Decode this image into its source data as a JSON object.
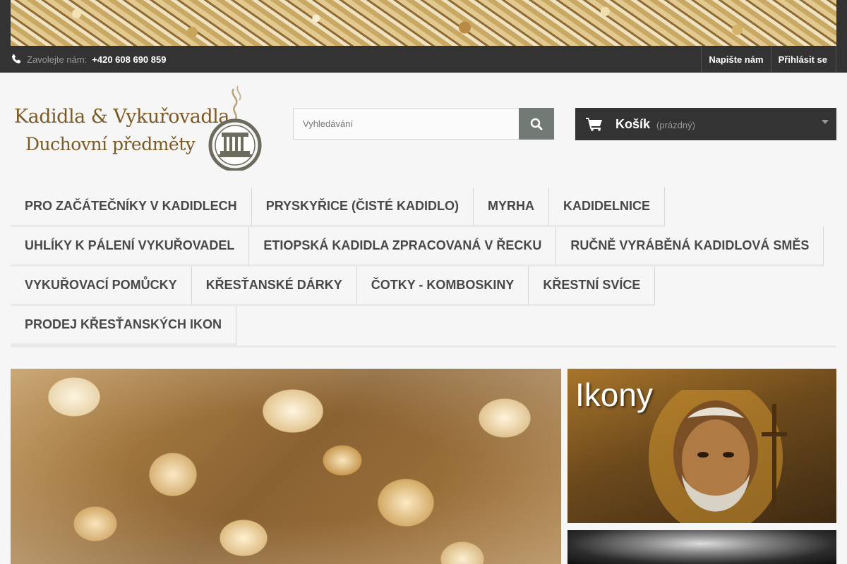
{
  "topbar": {
    "call_prefix": "Zavolejte nám:",
    "phone": "+420 608 690 859",
    "links": [
      "Napište nám",
      "Přihlásit se"
    ]
  },
  "logo": {
    "line1": "Kadidla & Vykuřovadla",
    "line2": "Duchovní předměty"
  },
  "search": {
    "placeholder": "Vyhledávání",
    "button_icon": "search-icon"
  },
  "cart": {
    "label": "Košík",
    "status": "(prázdný)",
    "icon": "cart-icon"
  },
  "menu": {
    "rows": [
      [
        "Pro začátečníky v kadidlech",
        "Pryskyřice (čisté kadidlo)",
        "Myrha",
        "Kadidelnice"
      ],
      [
        "Uhlíky k pálení vykuřovadel",
        "Etiopská kadidla zpracovaná v Řecku",
        "Ručně vyráběná kadidlová směs"
      ],
      [
        "Vykuřovací pomůcky",
        "Křesťanské dárky",
        "Čotky - komboskiny",
        "Křestní svíce"
      ],
      [
        "Prodej křesťanských ikon"
      ]
    ]
  },
  "promo": {
    "side_title": "Ikony"
  },
  "colors": {
    "dark_bar": "#333333",
    "search_button": "#717a74",
    "logo_gold": "#7a5a25"
  }
}
